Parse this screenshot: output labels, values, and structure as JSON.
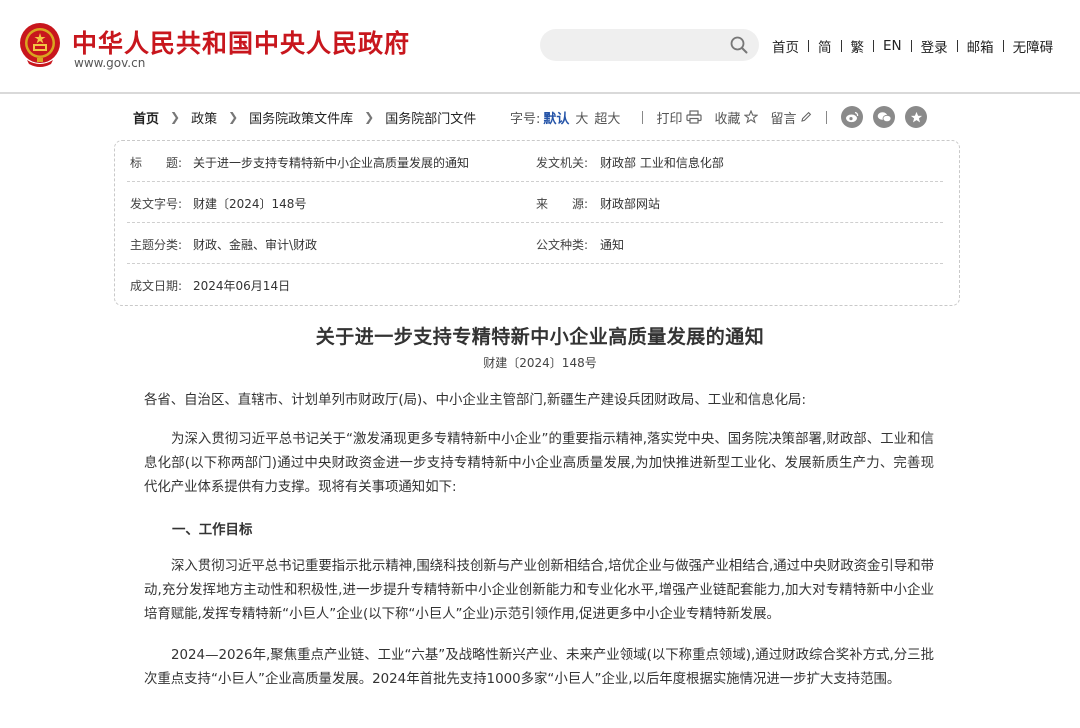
{
  "header": {
    "site_name": "中华人民共和国中央人民政府",
    "site_url": "www.gov.cn",
    "search": {
      "value": "",
      "placeholder": ""
    },
    "nav": [
      "首页",
      "简",
      "繁",
      "EN",
      "登录",
      "邮箱",
      "无障碍"
    ]
  },
  "breadcrumb": [
    "首页",
    "政策",
    "国务院政策文件库",
    "国务院部门文件"
  ],
  "toolbar": {
    "font_label": "字号:",
    "font_sizes": [
      "默认",
      "大",
      "超大"
    ],
    "print": "打印",
    "favorite": "收藏",
    "comment": "留言",
    "share_icons": [
      "weibo-icon",
      "wechat-icon",
      "star-icon"
    ]
  },
  "meta": {
    "title_key": "标　　题:",
    "title_val": "关于进一步支持专精特新中小企业高质量发展的通知",
    "issuer_key": "发文机关:",
    "issuer_val": "财政部  工业和信息化部",
    "docno_key": "发文字号:",
    "docno_val": "财建〔2024〕148号",
    "source_key": "来　　源:",
    "source_val": "财政部网站",
    "topic_key": "主题分类:",
    "topic_val": "财政、金融、审计\\财政",
    "type_key": "公文种类:",
    "type_val": "通知",
    "date_key": "成文日期:",
    "date_val": "2024年06月14日"
  },
  "article": {
    "title": "关于进一步支持专精特新中小企业高质量发展的通知",
    "doc_no": "财建〔2024〕148号",
    "salutation": "各省、自治区、直辖市、计划单列市财政厅(局)、中小企业主管部门,新疆生产建设兵团财政局、工业和信息化局:",
    "intro": "为深入贯彻习近平总书记关于“激发涌现更多专精特新中小企业”的重要指示精神,落实党中央、国务院决策部署,财政部、工业和信息化部(以下称两部门)通过中央财政资金进一步支持专精特新中小企业高质量发展,为加快推进新型工业化、发展新质生产力、完善现代化产业体系提供有力支撑。现将有关事项通知如下:",
    "section1_heading": "一、工作目标",
    "section1_p1": "深入贯彻习近平总书记重要指示批示精神,围绕科技创新与产业创新相结合,培优企业与做强产业相结合,通过中央财政资金引导和带动,充分发挥地方主动性和积极性,进一步提升专精特新中小企业创新能力和专业化水平,增强产业链配套能力,加大对专精特新中小企业培育赋能,发挥专精特新“小巨人”企业(以下称“小巨人”企业)示范引领作用,促进更多中小企业专精特新发展。",
    "section1_p2": "2024—2026年,聚焦重点产业链、工业“六基”及战略性新兴产业、未来产业领域(以下称重点领域),通过财政综合奖补方式,分三批次重点支持“小巨人”企业高质量发展。2024年首批先支持1000多家“小巨人”企业,以后年度根据实施情况进一步扩大支持范围。"
  }
}
